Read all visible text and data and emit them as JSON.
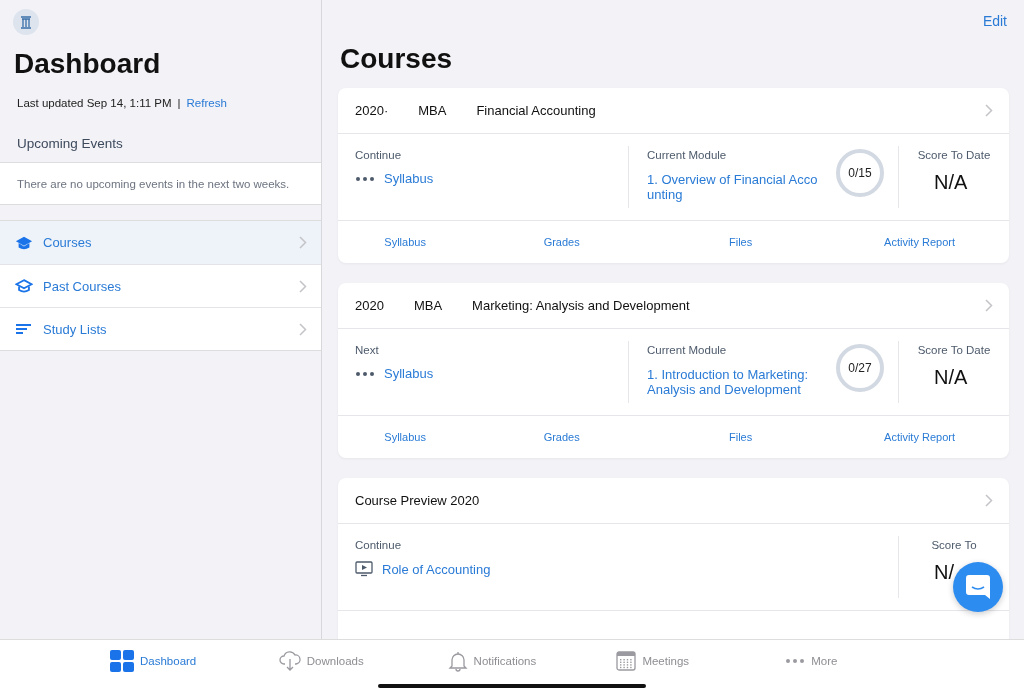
{
  "sidebar": {
    "title": "Dashboard",
    "last_updated": "Last updated Sep 14, 1:11 PM",
    "separator": "|",
    "refresh": "Refresh",
    "events_heading": "Upcoming Events",
    "events_empty": "There are no upcoming events in the next two weeks.",
    "items": [
      {
        "label": "Courses",
        "selected": true
      },
      {
        "label": "Past Courses",
        "selected": false
      },
      {
        "label": "Study Lists",
        "selected": false
      }
    ]
  },
  "main": {
    "edit": "Edit",
    "title": "Courses",
    "courses": [
      {
        "kind": "dots",
        "title_parts": [
          "2020·",
          "MBA",
          "Financial Accounting"
        ],
        "continue_label": "Continue",
        "continue_link": "Syllabus",
        "module_label": "Current Module",
        "module_link": "1. Overview of Financial Acco unting",
        "progress": "0/15",
        "level": 0,
        "score_label": "Score To Date",
        "score": "N/A",
        "links": [
          "Syllabus",
          "Grades",
          "Files",
          "Activity Report"
        ]
      },
      {
        "kind": "dots",
        "title_parts": [
          "2020",
          "MBA",
          "Marketing: Analysis and Development"
        ],
        "continue_label": "Next",
        "continue_link": "Syllabus",
        "module_label": "Current Module",
        "module_link": "1. Introduction to Marketing: Analysis and Development",
        "progress": "0/27",
        "level": 0,
        "score_label": "Score To Date",
        "score": "N/A",
        "links": [
          "Syllabus",
          "Grades",
          "Files",
          "Activity Report"
        ]
      },
      {
        "kind": "video",
        "title_parts": [
          "Course Preview 2020"
        ],
        "continue_label": "Continue",
        "continue_link": "Role of Accounting",
        "score_label": "Score To",
        "score": "N/"
      }
    ]
  },
  "tabbar": [
    {
      "label": "Dashboard",
      "selected": true
    },
    {
      "label": "Downloads",
      "selected": false
    },
    {
      "label": "Notifications",
      "selected": false
    },
    {
      "label": "Meetings",
      "selected": false
    },
    {
      "label": "More",
      "selected": false
    }
  ]
}
